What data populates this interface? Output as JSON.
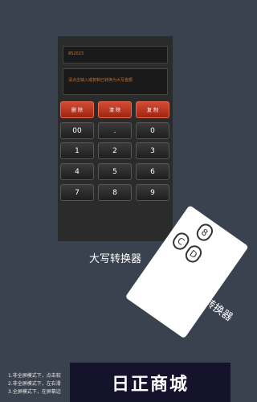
{
  "calculator": {
    "number_display": "852023",
    "result_display": "请点击输入或复制已转换为大写金额",
    "action_buttons": [
      "删 除",
      "清 除",
      "复 制"
    ],
    "keypad": [
      [
        "00",
        ".",
        "0"
      ],
      [
        "1",
        "2",
        "3"
      ],
      [
        "4",
        "5",
        "6"
      ],
      [
        "7",
        "8",
        "9"
      ]
    ]
  },
  "app_title": "大写转换器",
  "side_app": {
    "title": "进制转换器",
    "circles": [
      "8",
      "C",
      "D"
    ]
  },
  "notes": [
    "1.非全屏模式下，点击软",
    "2.非全屏模式下，左右滑",
    "3.全屏模式下，在屏幕边"
  ],
  "banner_text": "日正商城"
}
